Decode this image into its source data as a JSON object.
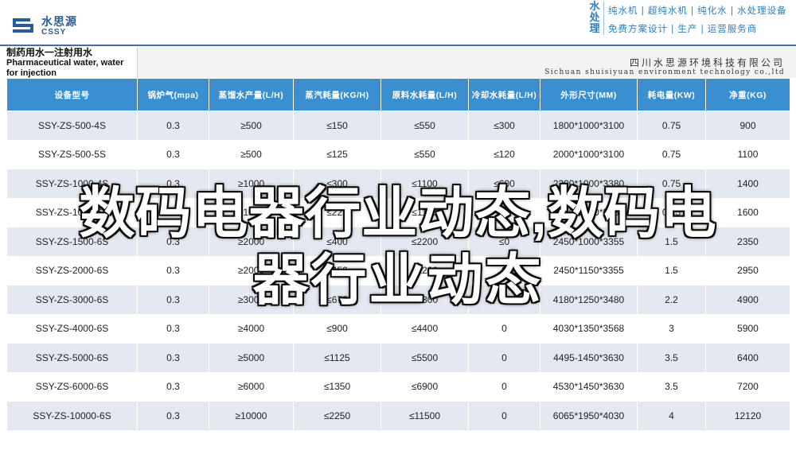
{
  "brand": {
    "name_cn": "水思源",
    "name_en": "CSSY",
    "accent_color": "#2b5c95"
  },
  "service": {
    "vertical_text": "水处理",
    "line1": "纯水机 | 超纯水机 | 纯化水 | 水处理设备",
    "line2": "免费方案设计 | 生产 | 运营服务商",
    "color": "#2b7ec0"
  },
  "product": {
    "title_cn": "制药用水一注射用水",
    "title_en": "Pharmaceutical water, water for injection"
  },
  "company": {
    "name_cn": "四川水思源环境科技有限公司",
    "name_en": "Sichuan shuisiyuan environment technology co.,ltd"
  },
  "table": {
    "header_color": "#3a8fd0",
    "columns": [
      "设备型号",
      "锅炉气(mpa)",
      "蒸馏水产量(L/H)",
      "蒸汽耗量(KG/H)",
      "原料水耗量(L/H)",
      "冷却水耗量(L/H)",
      "外形尺寸(MM)",
      "耗电量(KW)",
      "净重(KG)"
    ],
    "rows": [
      [
        "SSY-ZS-500-4S",
        "0.3",
        "≥500",
        "≤150",
        "≤550",
        "≤300",
        "1800*1000*3100",
        "0.75",
        "900"
      ],
      [
        "SSY-ZS-500-5S",
        "0.3",
        "≥500",
        "≤125",
        "≤550",
        "≤120",
        "2000*1000*3100",
        "0.75",
        "1100"
      ],
      [
        "SSY-ZS-1000-4S",
        "0.3",
        "≥1000",
        "≤300",
        "≤1100",
        "≤600",
        "2200*1000*3380",
        "0.75",
        "1400"
      ],
      [
        "SSY-ZS-1000-6S",
        "0.3",
        "≥1000",
        "≤225",
        "≤1100",
        "≤0",
        "2300*1000*3380",
        "0.75",
        "1600"
      ],
      [
        "SSY-ZS-1500-6S",
        "0.3",
        "≥2000",
        "≤400",
        "≤2200",
        "≤0",
        "2450*1000*3355",
        "1.5",
        "2350"
      ],
      [
        "SSY-ZS-2000-6S",
        "0.3",
        "≥2000",
        "≤450",
        "≤2200",
        "0",
        "2450*1150*3355",
        "1.5",
        "2950"
      ],
      [
        "SSY-ZS-3000-6S",
        "0.3",
        "≥3000",
        "≤675",
        "≤3300",
        "0",
        "4180*1250*3480",
        "2.2",
        "4900"
      ],
      [
        "SSY-ZS-4000-6S",
        "0.3",
        "≥4000",
        "≤900",
        "≤4400",
        "0",
        "4030*1350*3568",
        "3",
        "5900"
      ],
      [
        "SSY-ZS-5000-6S",
        "0.3",
        "≥5000",
        "≤1125",
        "≤5500",
        "0",
        "4495-1450*3630",
        "3.5",
        "6400"
      ],
      [
        "SSY-ZS-6000-6S",
        "0.3",
        "≥6000",
        "≤1350",
        "≤6900",
        "0",
        "4530*1450*3630",
        "3.5",
        "7200"
      ],
      [
        "SSY-ZS-10000-6S",
        "0.3",
        "≥10000",
        "≤2250",
        "≤11500",
        "0",
        "6065*1950*4030",
        "4",
        "12120"
      ]
    ]
  },
  "overlay": {
    "line1": "数码电器行业动态,数码电",
    "line2": "器行业动态"
  }
}
